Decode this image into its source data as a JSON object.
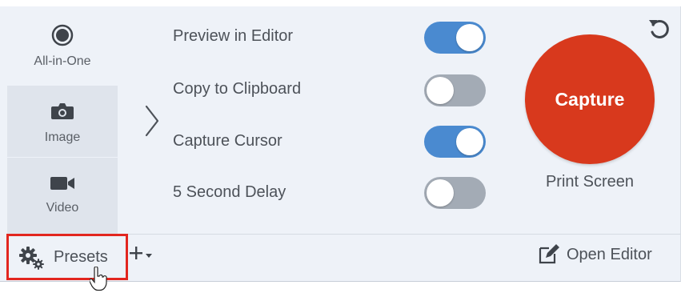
{
  "modes": [
    {
      "label": "All-in-One",
      "icon": "radio-record-icon"
    },
    {
      "label": "Image",
      "icon": "camera-icon"
    },
    {
      "label": "Video",
      "icon": "video-camera-icon"
    }
  ],
  "options": [
    {
      "label": "Preview in Editor",
      "enabled": true
    },
    {
      "label": "Copy to Clipboard",
      "enabled": false
    },
    {
      "label": "Capture Cursor",
      "enabled": true
    },
    {
      "label": "5 Second Delay",
      "enabled": false
    }
  ],
  "capture": {
    "button_label": "Capture",
    "hotkey": "Print Screen",
    "color": "#d8391d"
  },
  "footer": {
    "presets_label": "Presets",
    "open_editor_label": "Open Editor",
    "highlight_color": "#e2261f"
  },
  "colors": {
    "toggle_on": "#4a8ad0",
    "toggle_off": "#a3abb5",
    "panel_bg": "#eef2f8"
  }
}
